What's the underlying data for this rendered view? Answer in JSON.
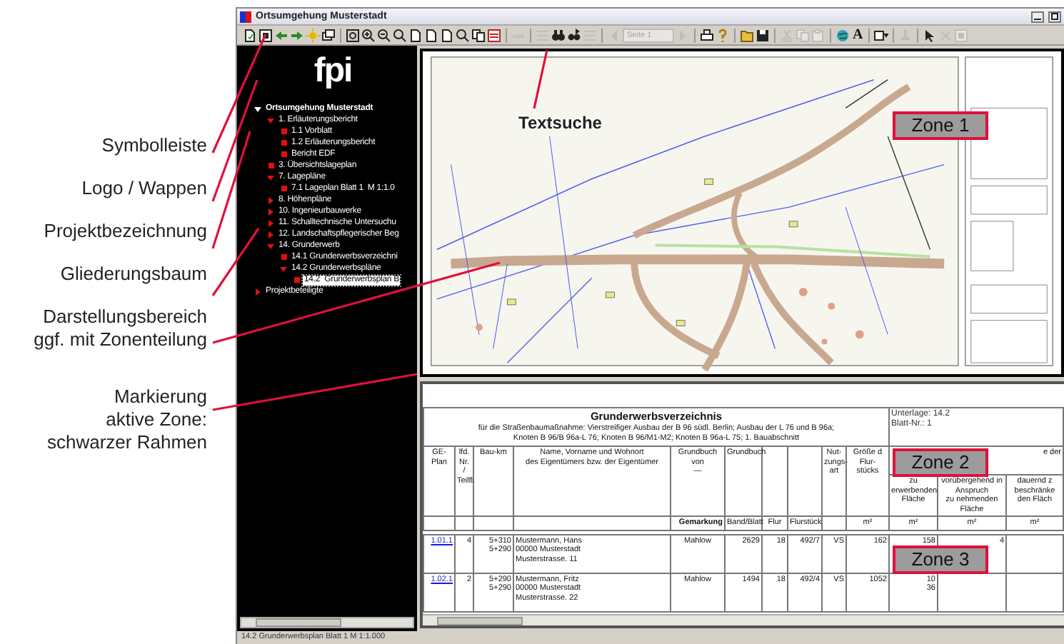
{
  "annotations": [
    {
      "text": "Symbolleiste"
    },
    {
      "text": "Logo / Wappen"
    },
    {
      "text": "Projektbezeichnung"
    },
    {
      "text": "Gliederungsbaum"
    },
    {
      "text": "Darstellungsbereich\nggf. mit Zonenteilung"
    },
    {
      "text": "Markierung\naktive Zone:\nschwarzer Rahmen"
    }
  ],
  "callout": {
    "text": "Textsuche"
  },
  "zones": [
    {
      "label": "Zone 1"
    },
    {
      "label": "Zone 2"
    },
    {
      "label": "Zone 3"
    }
  ],
  "window": {
    "title": "Ortsumgehung Musterstadt"
  },
  "toolbar": [
    {
      "kind": "document",
      "disabled": false
    },
    {
      "kind": "frame",
      "disabled": false
    },
    {
      "kind": "back",
      "disabled": false
    },
    {
      "kind": "forward",
      "disabled": false
    },
    {
      "kind": "sun",
      "disabled": false
    },
    {
      "kind": "windows",
      "disabled": false
    },
    {
      "kind": "separator"
    },
    {
      "kind": "zoom-fit",
      "disabled": false
    },
    {
      "kind": "zoom-in",
      "disabled": false
    },
    {
      "kind": "zoom-out",
      "disabled": false
    },
    {
      "kind": "magnifier",
      "disabled": false
    },
    {
      "kind": "page",
      "disabled": false
    },
    {
      "kind": "page",
      "disabled": false
    },
    {
      "kind": "page",
      "disabled": false
    },
    {
      "kind": "magnifier",
      "disabled": false
    },
    {
      "kind": "copy",
      "disabled": false
    },
    {
      "kind": "layers",
      "disabled": false
    },
    {
      "kind": "separator"
    },
    {
      "kind": "ruler",
      "disabled": true
    },
    {
      "kind": "separator"
    },
    {
      "kind": "list",
      "disabled": true
    },
    {
      "kind": "binoculars",
      "disabled": false
    },
    {
      "kind": "find-next",
      "disabled": false
    },
    {
      "kind": "list",
      "disabled": true
    },
    {
      "kind": "separator"
    },
    {
      "kind": "prev",
      "disabled": true
    },
    {
      "kind": "page-field",
      "value": "Seite 1",
      "disabled": true
    },
    {
      "kind": "next",
      "disabled": true
    },
    {
      "kind": "separator"
    },
    {
      "kind": "print",
      "disabled": false
    },
    {
      "kind": "help",
      "disabled": false
    },
    {
      "kind": "separator"
    },
    {
      "kind": "open",
      "disabled": false
    },
    {
      "kind": "save",
      "disabled": false
    },
    {
      "kind": "separator"
    },
    {
      "kind": "cut",
      "disabled": true
    },
    {
      "kind": "copy",
      "disabled": true
    },
    {
      "kind": "paste",
      "disabled": true
    },
    {
      "kind": "separator"
    },
    {
      "kind": "globe",
      "disabled": false
    },
    {
      "kind": "text-tool",
      "label": "A",
      "disabled": false
    },
    {
      "kind": "separator"
    },
    {
      "kind": "rectangle",
      "disabled": false
    },
    {
      "kind": "separator"
    },
    {
      "kind": "stamp",
      "disabled": true
    },
    {
      "kind": "separator"
    },
    {
      "kind": "pointer",
      "disabled": false
    },
    {
      "kind": "delete",
      "disabled": true
    },
    {
      "kind": "frame",
      "disabled": true
    }
  ],
  "sidebar": {
    "logo": "fpi",
    "tree": [
      {
        "label": "Ortsumgehung Musterstadt",
        "kind": "root",
        "expanded": true,
        "selected": false,
        "children": [
          {
            "label": "1. Erläuterungsbericht",
            "kind": "folder",
            "expanded": true,
            "selected": false,
            "children": [
              {
                "label": "1.1 Vorblatt",
                "kind": "document",
                "selected": false
              },
              {
                "label": "1.2 Erläuterungsbericht",
                "kind": "document",
                "selected": false
              },
              {
                "label": "Bericht EDF",
                "kind": "document",
                "selected": false
              }
            ]
          },
          {
            "label": "3. Übersichtslageplan",
            "kind": "document",
            "selected": false
          },
          {
            "label": "7. Lagepläne",
            "kind": "folder",
            "expanded": true,
            "selected": false,
            "children": [
              {
                "label": "7.1 Lageplan Blatt 1  M 1:1.0",
                "kind": "document",
                "selected": false
              }
            ]
          },
          {
            "label": "8. Höhenpläne",
            "kind": "folder",
            "expanded": false,
            "selected": false
          },
          {
            "label": "10. Ingenieurbauwerke",
            "kind": "folder",
            "expanded": false,
            "selected": false
          },
          {
            "label": "11. Schalltechnische Untersuchu",
            "kind": "folder",
            "expanded": false,
            "selected": false
          },
          {
            "label": "12. Landschaftspflegerischer Beg",
            "kind": "folder",
            "expanded": false,
            "selected": false
          },
          {
            "label": "14. Grunderwerb",
            "kind": "folder",
            "expanded": true,
            "selected": false,
            "children": [
              {
                "label": "14.1 Grunderwerbsverzeichni",
                "kind": "document",
                "selected": false
              },
              {
                "label": "14.2 Grunderwerbspläne",
                "kind": "folder",
                "expanded": true,
                "selected": false,
                "children": [
                  {
                    "label": "14.2  Grunderwerbsplan B",
                    "kind": "document",
                    "selected": true
                  }
                ]
              }
            ]
          }
        ]
      },
      {
        "label": "Projektbeteiligte",
        "kind": "folder",
        "expanded": false,
        "selected": false
      }
    ]
  },
  "table": {
    "title": "Grunderwerbsverzeichnis",
    "subtitle": "für die Straßenbaumaßnahme: Vierstreifiger Ausbau der B 96 südl. Berlin; Ausbau der L 76 und B 96a;\nKnoten B 96/B 96a-L 76; Knoten B 96/M1-M2; Knoten B 96a-L 75; 1. Bauabschnitt",
    "document": "Unterlage: 14.2",
    "sheet": "Blatt-Nr.: 1",
    "group_header": "e der",
    "columns": [
      {
        "label": "GE-\nPlan"
      },
      {
        "label": "lfd.\nNr.\n/\nTeilfl."
      },
      {
        "label": "Bau-km"
      },
      {
        "label": "Name, Vorname und Wohnort\ndes Eigentümers bzw. der Eigentümer"
      },
      {
        "label": "Grundbuch\nvon\n—",
        "unit": "Gemarkung"
      },
      {
        "label": "Grundbuch",
        "unit": "Band/Blatt"
      },
      {
        "unit": "Flur"
      },
      {
        "unit": "Flurstück"
      },
      {
        "label": "Nut-\nzungs-\nart"
      },
      {
        "label": "Größe d\nFlur-\nstücks",
        "unit": "m²"
      },
      {
        "label": "zu\nerwerbenden\nFläche",
        "unit": "m²"
      },
      {
        "label": "vorübergehend in\nAnspruch\nzu nehmenden\nFläche",
        "unit": "m²"
      },
      {
        "label": "dauernd z\nbeschränke\nden Fläch",
        "unit": "m²"
      }
    ],
    "rows": [
      [
        "1.01.1",
        "4",
        "5+310\n5+290",
        "Mustermann, Hans\n00000 Musterstadt\nMusterstrasse. 11",
        "Mahlow",
        "2629",
        "18",
        "492/7",
        "VS",
        "162",
        "158",
        "4",
        null
      ],
      [
        "1.02.1",
        "2",
        "5+290\n5+290",
        "Mustermann, Fritz\n00000 Musterstadt\nMusterstrasse. 22",
        "Mahlow",
        "1494",
        "18",
        "492/4",
        "VS",
        "1052",
        "10\n36",
        null,
        null
      ]
    ]
  },
  "status_bar": {
    "text": "14.2 Grunderwerbsplan Blatt 1  M 1:1.000"
  }
}
